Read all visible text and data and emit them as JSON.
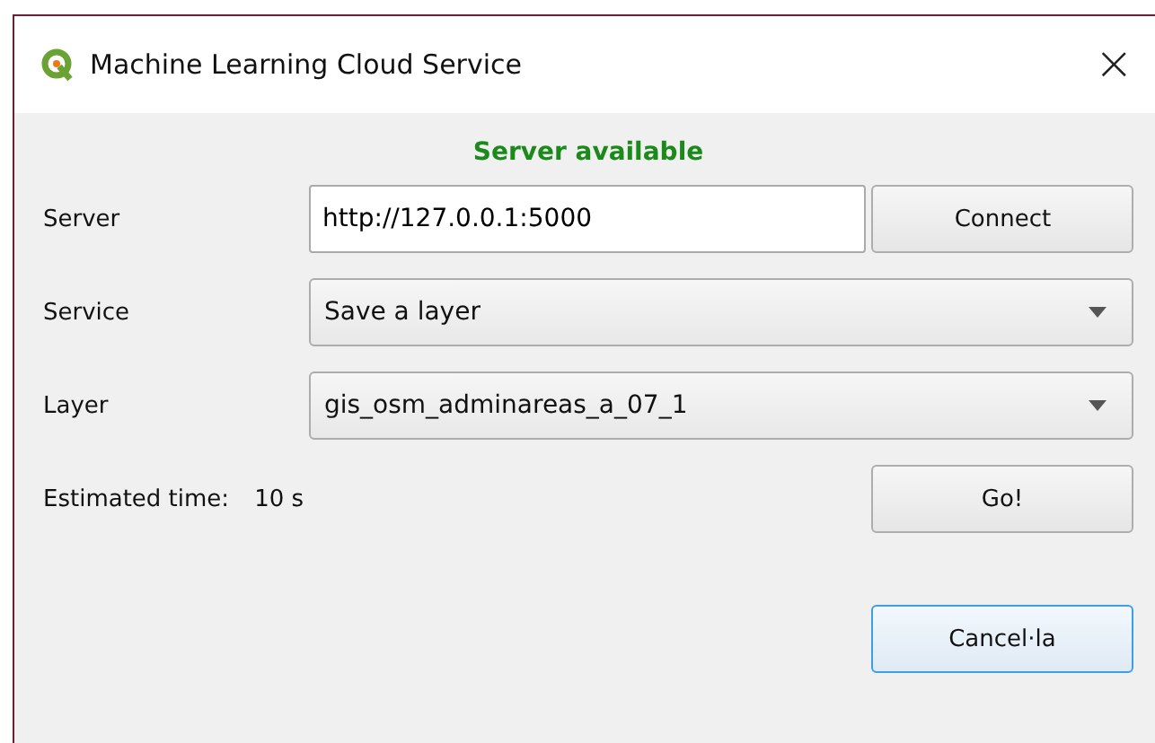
{
  "window": {
    "title": "Machine Learning Cloud Service",
    "close": "×"
  },
  "status": "Server available",
  "rows": [
    {
      "kind": "text",
      "label": "Server",
      "value": "http://127.0.0.1:5000",
      "button": "Connect"
    },
    {
      "kind": "combo",
      "label": "Service",
      "value": "Save a layer"
    },
    {
      "kind": "combo",
      "label": "Layer",
      "value": "gis_osm_adminareas_a_07_1"
    }
  ],
  "estimate": {
    "label": "Estimated time:",
    "value": "10 s",
    "button": "Go!"
  },
  "footer_button": {
    "label": "Cancel·la",
    "focused": true
  }
}
